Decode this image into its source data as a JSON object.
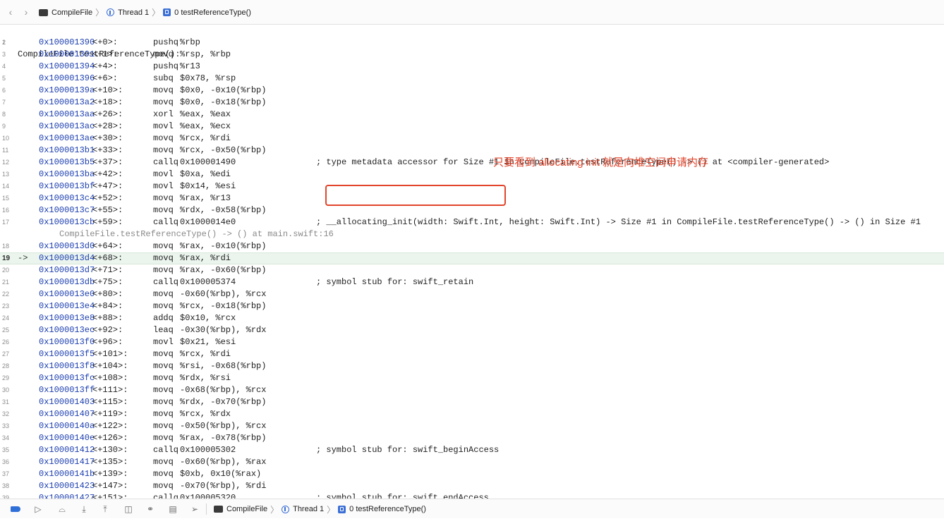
{
  "jumpbar": {
    "back_icon": "chevron-left-icon",
    "forward_icon": "chevron-right-icon",
    "file": "CompileFile",
    "thread": "Thread 1",
    "frame": "0 testReferenceType()"
  },
  "disassembly": {
    "title": "CompileFile`testReferenceType():",
    "pc_arrow": "->",
    "wrapped_text": "CompileFile.testReferenceType() -> () at main.swift:16",
    "lines": [
      {
        "num": "2",
        "addr": "0x100001390",
        "off": "<+0>:",
        "op": "pushq",
        "arg": "%rbp",
        "comment": ""
      },
      {
        "num": "3",
        "addr": "0x100001391",
        "off": "<+1>:",
        "op": "movq",
        "arg": "%rsp, %rbp",
        "comment": ""
      },
      {
        "num": "4",
        "addr": "0x100001394",
        "off": "<+4>:",
        "op": "pushq",
        "arg": "%r13",
        "comment": ""
      },
      {
        "num": "5",
        "addr": "0x100001396",
        "off": "<+6>:",
        "op": "subq",
        "arg": "$0x78, %rsp",
        "comment": ""
      },
      {
        "num": "6",
        "addr": "0x10000139a",
        "off": "<+10>:",
        "op": "movq",
        "arg": "$0x0, -0x10(%rbp)",
        "comment": ""
      },
      {
        "num": "7",
        "addr": "0x1000013a2",
        "off": "<+18>:",
        "op": "movq",
        "arg": "$0x0, -0x18(%rbp)",
        "comment": ""
      },
      {
        "num": "8",
        "addr": "0x1000013aa",
        "off": "<+26>:",
        "op": "xorl",
        "arg": "%eax, %eax",
        "comment": ""
      },
      {
        "num": "9",
        "addr": "0x1000013ac",
        "off": "<+28>:",
        "op": "movl",
        "arg": "%eax, %ecx",
        "comment": ""
      },
      {
        "num": "10",
        "addr": "0x1000013ae",
        "off": "<+30>:",
        "op": "movq",
        "arg": "%rcx, %rdi",
        "comment": ""
      },
      {
        "num": "11",
        "addr": "0x1000013b1",
        "off": "<+33>:",
        "op": "movq",
        "arg": "%rcx, -0x50(%rbp)",
        "comment": ""
      },
      {
        "num": "12",
        "addr": "0x1000013b5",
        "off": "<+37>:",
        "op": "callq",
        "arg": "0x100001490",
        "comment": "; type metadata accessor for Size #1 in CompileFile.testReferenceType() -> () at <compiler-generated>"
      },
      {
        "num": "13",
        "addr": "0x1000013ba",
        "off": "<+42>:",
        "op": "movl",
        "arg": "$0xa, %edi",
        "comment": ""
      },
      {
        "num": "14",
        "addr": "0x1000013bf",
        "off": "<+47>:",
        "op": "movl",
        "arg": "$0x14, %esi",
        "comment": ""
      },
      {
        "num": "15",
        "addr": "0x1000013c4",
        "off": "<+52>:",
        "op": "movq",
        "arg": "%rax, %r13",
        "comment": ""
      },
      {
        "num": "16",
        "addr": "0x1000013c7",
        "off": "<+55>:",
        "op": "movq",
        "arg": "%rdx, -0x58(%rbp)",
        "comment": ""
      },
      {
        "num": "17",
        "addr": "0x1000013cb",
        "off": "<+59>:",
        "op": "callq",
        "arg": "0x1000014e0",
        "comment": "; __allocating_init(width: Swift.Int, height: Swift.Int) -> Size #1 in CompileFile.testReferenceType() -> () in Size #1"
      },
      {
        "num": "18",
        "addr": "0x1000013d0",
        "off": "<+64>:",
        "op": "movq",
        "arg": "%rax, -0x10(%rbp)",
        "comment": ""
      },
      {
        "num": "19",
        "addr": "0x1000013d4",
        "off": "<+68>:",
        "op": "movq",
        "arg": "%rax, %rdi",
        "comment": ""
      },
      {
        "num": "20",
        "addr": "0x1000013d7",
        "off": "<+71>:",
        "op": "movq",
        "arg": "%rax, -0x60(%rbp)",
        "comment": ""
      },
      {
        "num": "21",
        "addr": "0x1000013db",
        "off": "<+75>:",
        "op": "callq",
        "arg": "0x100005374",
        "comment": "; symbol stub for: swift_retain"
      },
      {
        "num": "22",
        "addr": "0x1000013e0",
        "off": "<+80>:",
        "op": "movq",
        "arg": "-0x60(%rbp), %rcx",
        "comment": ""
      },
      {
        "num": "23",
        "addr": "0x1000013e4",
        "off": "<+84>:",
        "op": "movq",
        "arg": "%rcx, -0x18(%rbp)",
        "comment": ""
      },
      {
        "num": "24",
        "addr": "0x1000013e8",
        "off": "<+88>:",
        "op": "addq",
        "arg": "$0x10, %rcx",
        "comment": ""
      },
      {
        "num": "25",
        "addr": "0x1000013ec",
        "off": "<+92>:",
        "op": "leaq",
        "arg": "-0x30(%rbp), %rdx",
        "comment": ""
      },
      {
        "num": "26",
        "addr": "0x1000013f0",
        "off": "<+96>:",
        "op": "movl",
        "arg": "$0x21, %esi",
        "comment": ""
      },
      {
        "num": "27",
        "addr": "0x1000013f5",
        "off": "<+101>:",
        "op": "movq",
        "arg": "%rcx, %rdi",
        "comment": ""
      },
      {
        "num": "28",
        "addr": "0x1000013f8",
        "off": "<+104>:",
        "op": "movq",
        "arg": "%rsi, -0x68(%rbp)",
        "comment": ""
      },
      {
        "num": "29",
        "addr": "0x1000013fc",
        "off": "<+108>:",
        "op": "movq",
        "arg": "%rdx, %rsi",
        "comment": ""
      },
      {
        "num": "30",
        "addr": "0x1000013ff",
        "off": "<+111>:",
        "op": "movq",
        "arg": "-0x68(%rbp), %rcx",
        "comment": ""
      },
      {
        "num": "31",
        "addr": "0x100001403",
        "off": "<+115>:",
        "op": "movq",
        "arg": "%rdx, -0x70(%rbp)",
        "comment": ""
      },
      {
        "num": "32",
        "addr": "0x100001407",
        "off": "<+119>:",
        "op": "movq",
        "arg": "%rcx, %rdx",
        "comment": ""
      },
      {
        "num": "33",
        "addr": "0x10000140a",
        "off": "<+122>:",
        "op": "movq",
        "arg": "-0x50(%rbp), %rcx",
        "comment": ""
      },
      {
        "num": "34",
        "addr": "0x10000140e",
        "off": "<+126>:",
        "op": "movq",
        "arg": "%rax, -0x78(%rbp)",
        "comment": ""
      },
      {
        "num": "35",
        "addr": "0x100001412",
        "off": "<+130>:",
        "op": "callq",
        "arg": "0x100005302",
        "comment": "; symbol stub for: swift_beginAccess"
      },
      {
        "num": "36",
        "addr": "0x100001417",
        "off": "<+135>:",
        "op": "movq",
        "arg": "-0x60(%rbp), %rax",
        "comment": ""
      },
      {
        "num": "37",
        "addr": "0x10000141b",
        "off": "<+139>:",
        "op": "movq",
        "arg": "$0xb, 0x10(%rax)",
        "comment": ""
      },
      {
        "num": "38",
        "addr": "0x100001423",
        "off": "<+147>:",
        "op": "movq",
        "arg": "-0x70(%rbp), %rdi",
        "comment": ""
      },
      {
        "num": "39",
        "addr": "0x100001427",
        "off": "<+151>:",
        "op": "callq",
        "arg": "0x100005320",
        "comment": "; symbol stub for: swift_endAccess"
      }
    ]
  },
  "annotation": {
    "text": "只要看到 allocating init 就是向堆空间申请内存",
    "color": "#e2452b"
  },
  "debugbar": {
    "icons": [
      "breakpoints-toggle-icon",
      "continue-icon",
      "step-over-icon",
      "step-into-icon",
      "step-out-icon",
      "view-hierarchy-icon",
      "memory-graph-icon",
      "environment-overrides-icon",
      "simulate-location-icon"
    ],
    "file": "CompileFile",
    "thread": "Thread 1",
    "frame": "0 testReferenceType()"
  },
  "colors": {
    "accent": "#2f6fd8",
    "address": "#1c3fb0",
    "current_line": "#ebf5ee"
  }
}
